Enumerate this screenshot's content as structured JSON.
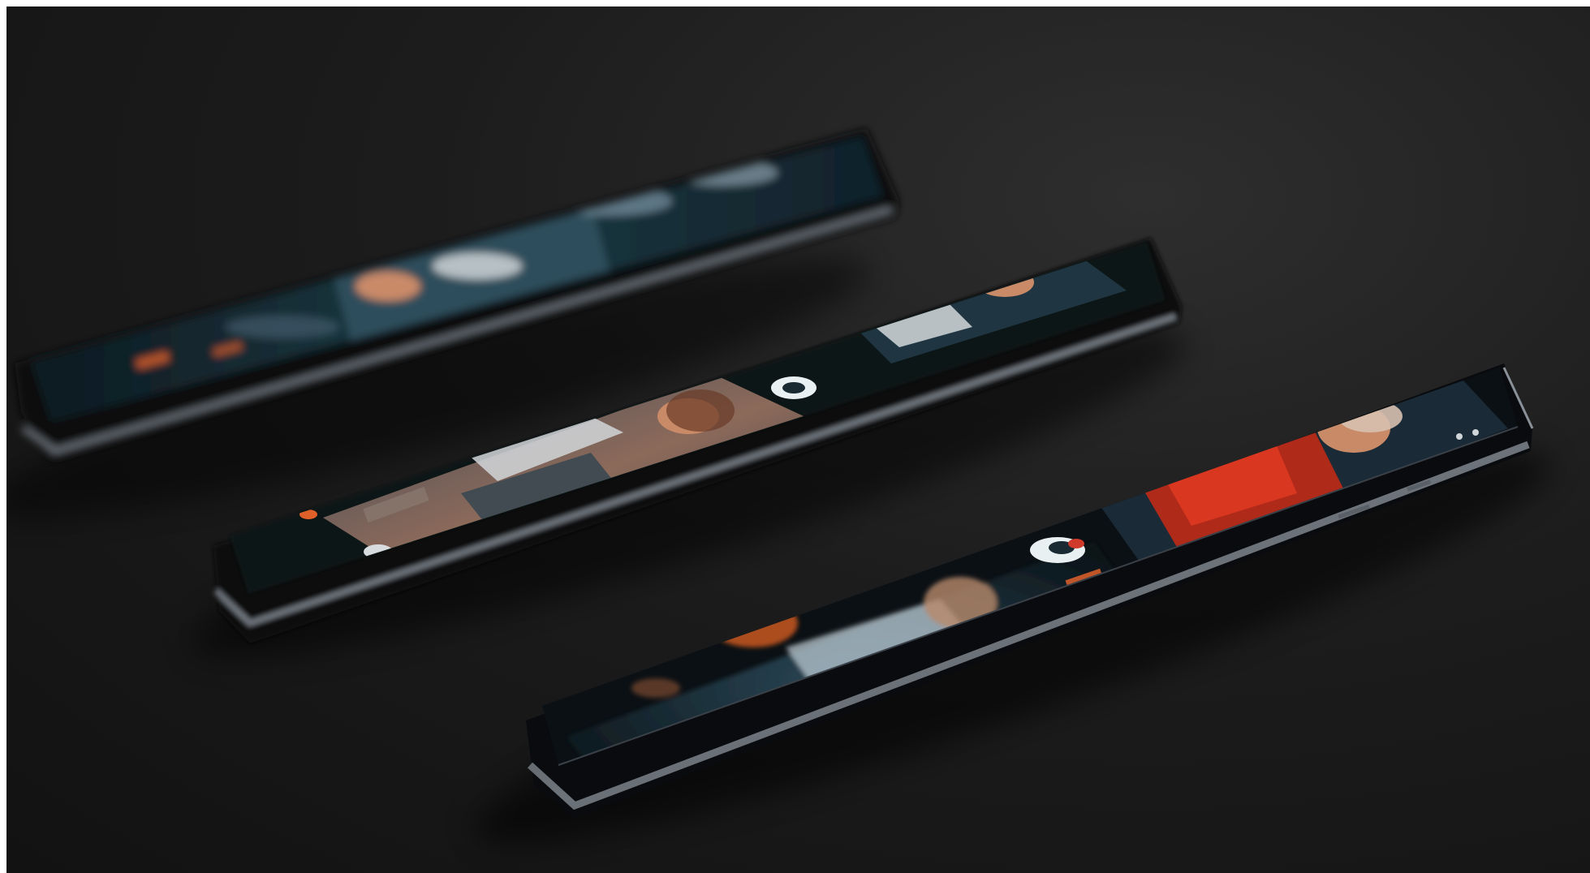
{
  "image": {
    "description_free": true,
    "colors": {
      "background": "#1a1a1a",
      "phone_body": "#0c0f12",
      "phone_rim": "#5a6068",
      "screen_teal": "#1d3a44",
      "accent_orange": "#e0602a",
      "accent_red": "#c0281e",
      "skin_tone": "#c98a68"
    },
    "phones": [
      {
        "id": "phone-back",
        "focus": "blurred"
      },
      {
        "id": "phone-middle",
        "focus": "medium"
      },
      {
        "id": "phone-front",
        "focus": "sharp-top"
      }
    ]
  }
}
